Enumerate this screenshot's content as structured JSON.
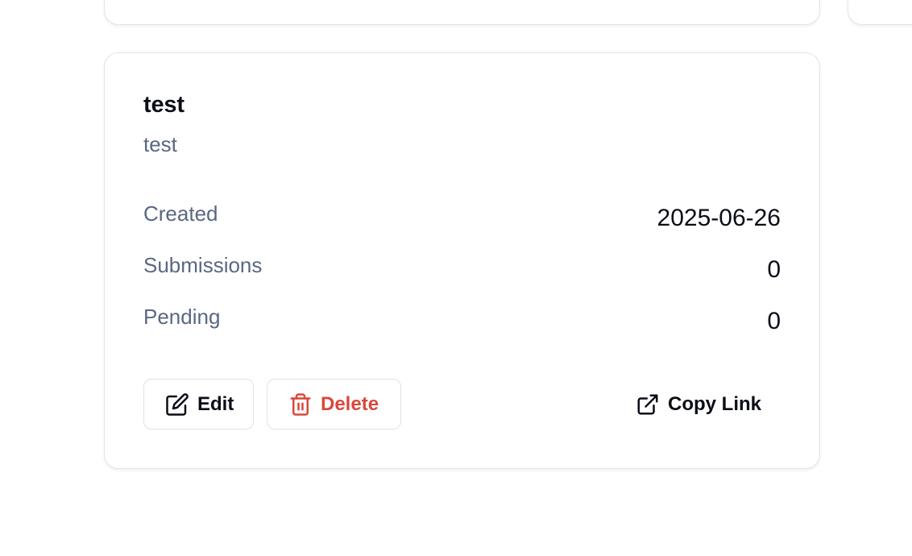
{
  "card": {
    "title": "test",
    "description": "test",
    "stats": [
      {
        "label": "Created",
        "value": "2025-06-26"
      },
      {
        "label": "Submissions",
        "value": "0"
      },
      {
        "label": "Pending",
        "value": "0"
      }
    ],
    "actions": {
      "edit_label": "Edit",
      "delete_label": "Delete",
      "copy_label": "Copy Link"
    }
  },
  "colors": {
    "text_primary": "#0b0d17",
    "text_muted": "#5a6782",
    "danger": "#d9483b",
    "border": "#e2e4ee"
  },
  "icons": {
    "edit": "edit-icon",
    "delete": "trash-icon",
    "copy": "external-link-icon"
  }
}
